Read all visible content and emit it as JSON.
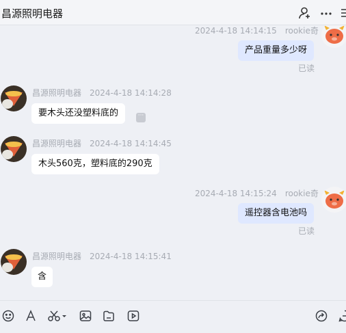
{
  "header": {
    "title": "昌源照明电器",
    "icons": [
      "add-user-icon",
      "more-icon",
      "side-panel-icon"
    ]
  },
  "messages": [
    {
      "direction": "out",
      "sender": "rookie奇",
      "time": "2024-4-18 14:14:15",
      "text": "产品重量多少呀",
      "status": "已读"
    },
    {
      "direction": "in",
      "sender": "昌源照明电器",
      "time": "2024-4-18 14:14:28",
      "text": "要木头还没塑料底的"
    },
    {
      "direction": "in",
      "sender": "昌源照明电器",
      "time": "2024-4-18 14:14:45",
      "text": "木头560克，塑料底的290克"
    },
    {
      "direction": "out",
      "sender": "rookie奇",
      "time": "2024-4-18 14:15:24",
      "text": "遥控器含电池吗",
      "status": "已读"
    },
    {
      "direction": "in",
      "sender": "昌源照明电器",
      "time": "2024-4-18 14:15:41",
      "text": "含"
    }
  ],
  "toolbar": {
    "icons": [
      "emoji-icon",
      "font-icon",
      "scissors-icon",
      "image-icon",
      "folder-icon",
      "video-icon",
      "share-icon",
      "chat-history-icon"
    ]
  },
  "colors": {
    "background": "#eef0f5",
    "outgoing_bubble": "#dfe8ff",
    "incoming_bubble": "#ffffff",
    "meta_text": "#a7abb3"
  }
}
